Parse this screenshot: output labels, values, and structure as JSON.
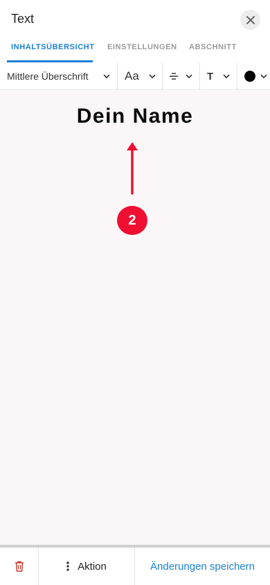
{
  "header": {
    "title": "Text",
    "close_icon": "close-icon"
  },
  "tabs": [
    {
      "label": "INHALTSÜBERSICHT",
      "active": true
    },
    {
      "label": "EINSTELLUNGEN",
      "active": false
    },
    {
      "label": "ABSCHNITT",
      "active": false
    }
  ],
  "toolbar": {
    "style_select": "Mittlere Überschrift",
    "font_size_label": "Aa",
    "align_icon": "align-center-icon",
    "text_format_label": "T",
    "color_value": "#000000"
  },
  "canvas": {
    "heading_text": "Dein Name",
    "step_number": "2",
    "accent_color": "#ee0f33"
  },
  "bottombar": {
    "delete_icon": "trash-icon",
    "action_label": "Aktion",
    "save_label": "Änderungen speichern"
  },
  "colors": {
    "accent": "#1a7fd6",
    "danger": "#c0392b"
  }
}
